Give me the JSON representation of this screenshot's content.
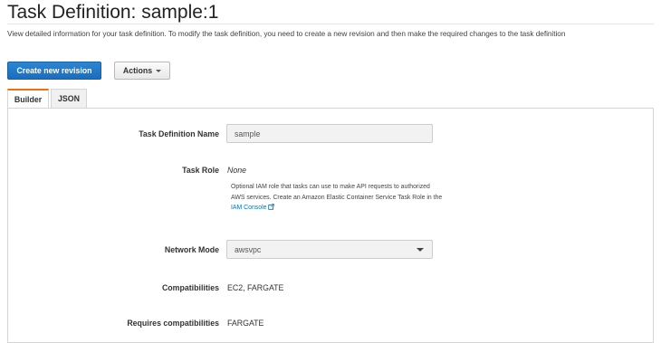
{
  "page": {
    "title": "Task Definition: sample:1",
    "description": "View detailed information for your task definition. To modify the task definition, you need to create a new revision and then make the required changes to the task definition"
  },
  "toolbar": {
    "create_revision_label": "Create new revision",
    "actions_label": "Actions"
  },
  "tabs": [
    {
      "label": "Builder",
      "active": true
    },
    {
      "label": "JSON",
      "active": false
    }
  ],
  "form": {
    "task_definition_name": {
      "label": "Task Definition Name",
      "value": "sample"
    },
    "task_role": {
      "label": "Task Role",
      "value": "None",
      "help_text": "Optional IAM role that tasks can use to make API requests to authorized AWS services. Create an Amazon Elastic Container Service Task Role in the ",
      "help_link": "IAM Console"
    },
    "network_mode": {
      "label": "Network Mode",
      "value": "awsvpc"
    },
    "compatibilities": {
      "label": "Compatibilities",
      "value": "EC2, FARGATE"
    },
    "requires_compatibilities": {
      "label": "Requires compatibilities",
      "value": "FARGATE"
    }
  },
  "colors": {
    "primary_button": "#1a6dbd",
    "active_tab_accent": "#ec7211",
    "link": "#0073bb"
  },
  "icons": {
    "actions_caret": "caret-down-icon",
    "select_arrow": "chevron-down-icon",
    "external_link": "external-link-icon"
  }
}
